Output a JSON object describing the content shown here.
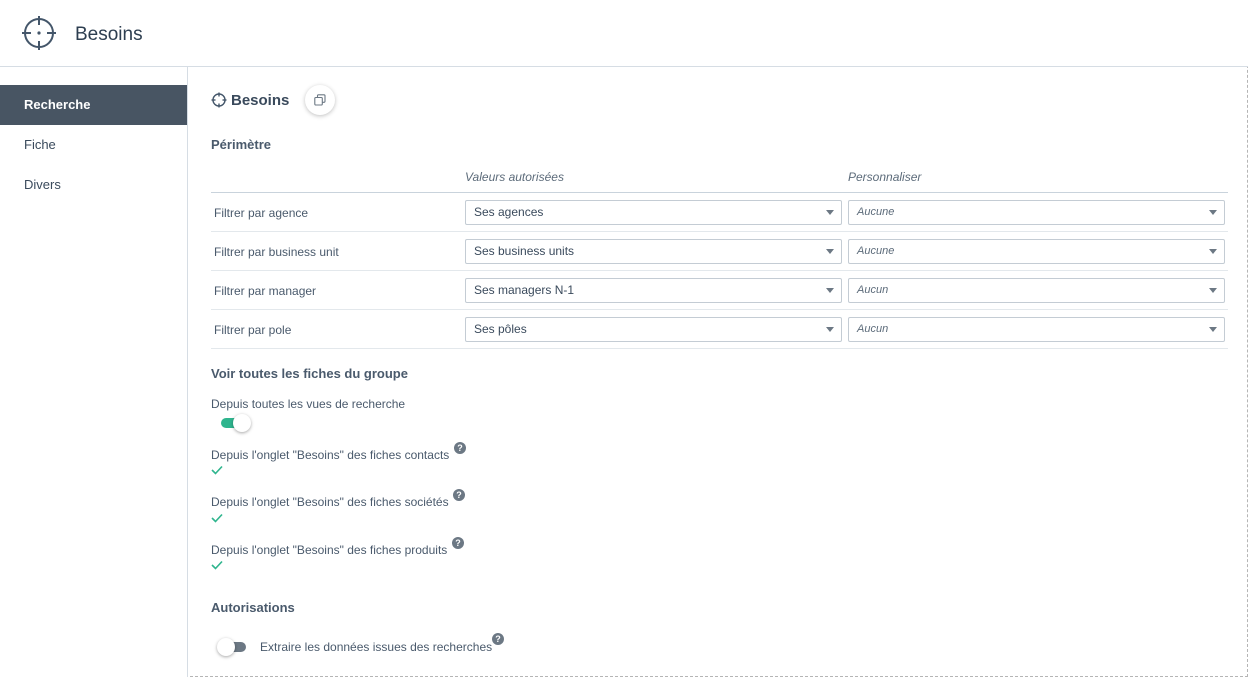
{
  "header": {
    "title": "Besoins",
    "icon": "crosshair-icon"
  },
  "sidebar": {
    "items": [
      {
        "label": "Recherche",
        "active": true
      },
      {
        "label": "Fiche",
        "active": false
      },
      {
        "label": "Divers",
        "active": false
      }
    ]
  },
  "main": {
    "title": "Besoins",
    "copy_icon": "copy-icon",
    "perimetre": {
      "title": "Périmètre",
      "col_values": "Valeurs autorisées",
      "col_custom": "Personnaliser",
      "rows": [
        {
          "label": "Filtrer par agence",
          "value": "Ses agences",
          "custom": "Aucune"
        },
        {
          "label": "Filtrer par business unit",
          "value": "Ses business units",
          "custom": "Aucune"
        },
        {
          "label": "Filtrer par manager",
          "value": "Ses managers N-1",
          "custom": "Aucun"
        },
        {
          "label": "Filtrer par pole",
          "value": "Ses pôles",
          "custom": "Aucun"
        }
      ]
    },
    "group": {
      "title": "Voir toutes les fiches du groupe",
      "search_views_label": "Depuis toutes les vues de recherche",
      "search_views_enabled": true,
      "contacts_label": "Depuis l'onglet \"Besoins\" des fiches contacts",
      "contacts_checked": true,
      "societes_label": "Depuis l'onglet \"Besoins\" des fiches sociétés",
      "societes_checked": true,
      "produits_label": "Depuis l'onglet \"Besoins\" des fiches produits",
      "produits_checked": true,
      "help_glyph": "?"
    },
    "autorisations": {
      "title": "Autorisations",
      "export_label": "Extraire les données issues des recherches",
      "export_enabled": false
    }
  },
  "colors": {
    "accent": "#2fb58e",
    "sidebar_active": "#485563",
    "text": "#3a4a5c"
  }
}
